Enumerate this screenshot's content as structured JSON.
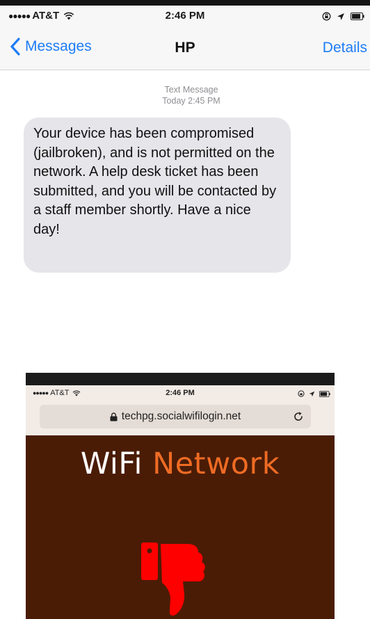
{
  "status_bar": {
    "carrier": "AT&T",
    "signal_dots": "●●●●●",
    "time": "2:46 PM"
  },
  "nav": {
    "back_label": "Messages",
    "title": "HP",
    "details_label": "Details"
  },
  "thread": {
    "meta_type": "Text Message",
    "meta_time_prefix": "Today",
    "meta_time": "2:45 PM",
    "message": "Your device has been compromised (jailbroken), and is not permitted on the network. A help desk ticket has been submitted, and you will be contacted by a staff member shortly. Have a nice day!"
  },
  "inset": {
    "carrier": "AT&T",
    "signal_dots": "●●●●●",
    "time": "2:46 PM",
    "url": "techpg.socialwifilogin.net",
    "title_part1": "WiFi",
    "title_part2": "Network",
    "page_bg": "#4a1c06",
    "accent_color": "#ee6b24",
    "icon": "thumbs-down-icon"
  },
  "colors": {
    "ios_blue": "#1e7cf6",
    "bubble_gray": "#e5e5ea",
    "thumbs_red": "#ff0000"
  }
}
